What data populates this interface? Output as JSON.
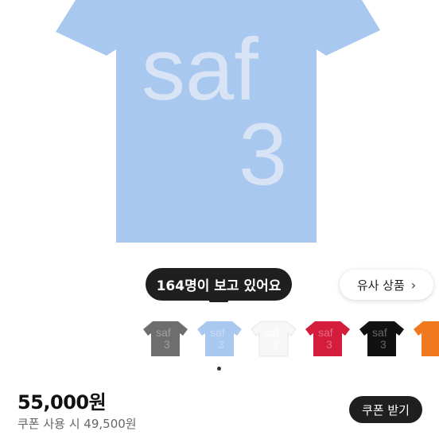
{
  "hero": {
    "shirt_color": "#a9c8ef",
    "print_line1": "saf",
    "print_line2": "3"
  },
  "viewers_badge": {
    "text": "164명이 보고 있어요"
  },
  "similar_button": {
    "label": "유사 상품",
    "icon": "chevron-right-icon"
  },
  "thumbnails": [
    {
      "color": "#6e6e6e",
      "print": "saf",
      "print2": "3"
    },
    {
      "color": "#a9c8ef",
      "print": "saf",
      "print2": "3"
    },
    {
      "color": "#f7f7f7",
      "print": "saf",
      "print2": "3"
    },
    {
      "color": "#d41c3c",
      "print": "saf",
      "print2": "3"
    },
    {
      "color": "#111111",
      "print": "saf",
      "print2": "3"
    },
    {
      "color": "#f0791f",
      "print": "",
      "print2": ""
    }
  ],
  "price": {
    "main": "55,000원",
    "coupon_text": "쿠폰 사용 시 49,500원"
  },
  "coupon_button": {
    "label": "쿠폰 받기"
  }
}
